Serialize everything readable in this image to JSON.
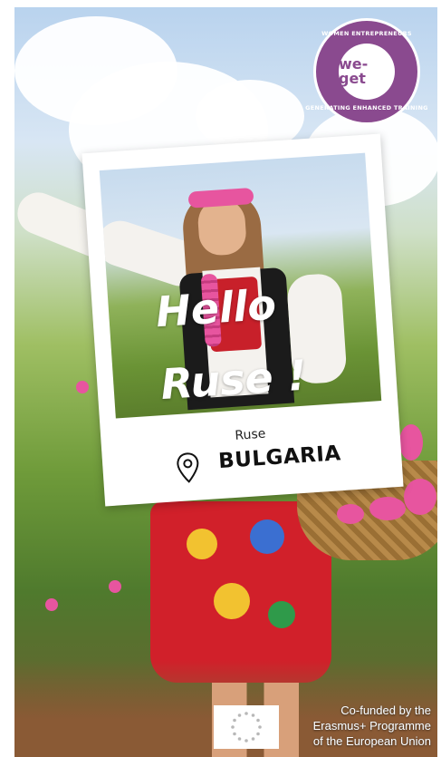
{
  "logo": {
    "brand": "we-get",
    "ring_top": "WOMEN ENTREPRENEURS",
    "ring_bottom": "GENERATING ENHANCED TRAINING",
    "color": "#8a4a8f"
  },
  "card": {
    "greeting_line1": "Hello",
    "greeting_line2": "Ruse !",
    "city": "Ruse",
    "country": "BULGARIA",
    "pin_icon": "location-pin-icon"
  },
  "footer": {
    "caption_line1": "Co-funded by the",
    "caption_line2": "Erasmus+ Programme",
    "caption_line3": "of the European Union",
    "flag_icon": "eu-flag-icon"
  },
  "colors": {
    "rose": "#e7559f",
    "skirt_red": "#d1202a",
    "vest_black": "#1b1b1b"
  }
}
